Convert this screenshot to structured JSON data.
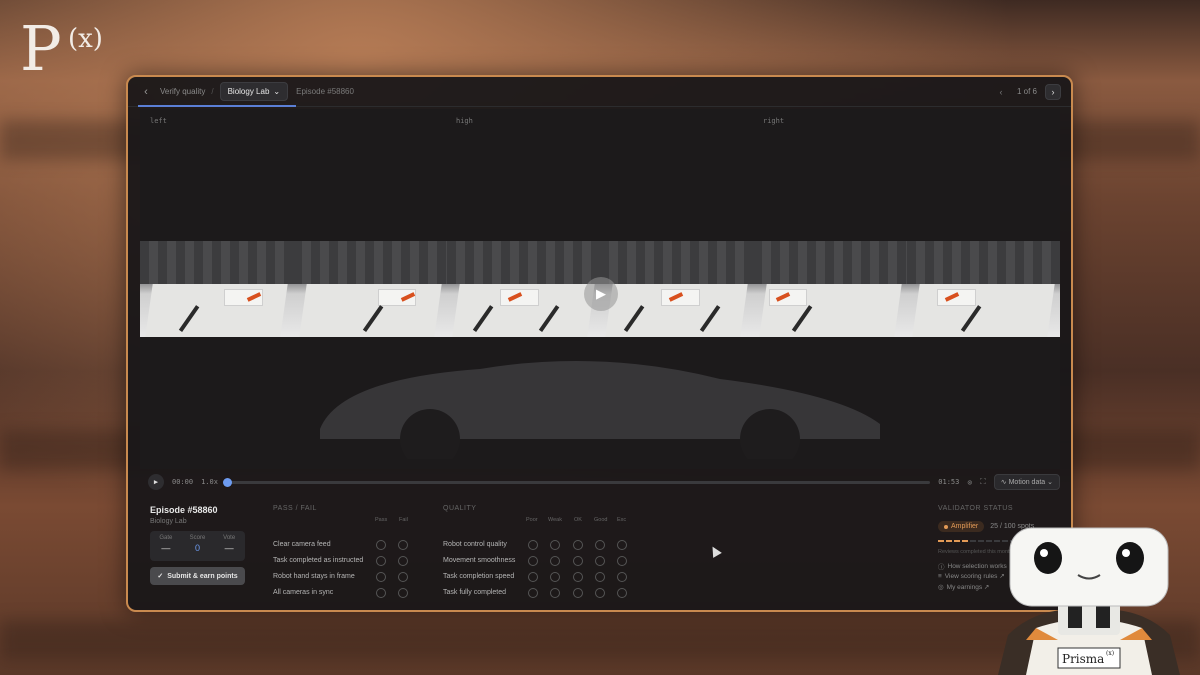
{
  "brand": {
    "logo_letter": "P",
    "logo_super": "(x)"
  },
  "header": {
    "back_icon": "chevron-left-icon",
    "crumb": "Verify quality",
    "project": "Biology Lab",
    "episode": "Episode #58860",
    "pager": "1 of 6"
  },
  "video": {
    "camera_labels": [
      "left",
      "high",
      "right"
    ],
    "time_current": "00:00",
    "speed": "1.0x",
    "time_total": "01:53",
    "progress_fraction": 0.0,
    "motion_button": "Motion data"
  },
  "episode_panel": {
    "title": "Episode #58860",
    "subtitle": "Biology Lab",
    "stats": [
      {
        "label": "Gate",
        "value": "—"
      },
      {
        "label": "Score",
        "value": "0"
      },
      {
        "label": "Vote",
        "value": "—"
      }
    ],
    "submit_label": "Submit & earn points"
  },
  "pass_fail": {
    "heading": "PASS / FAIL",
    "columns": [
      "Pass",
      "Fail"
    ],
    "rows": [
      "Clear camera feed",
      "Task completed as instructed",
      "Robot hand stays in frame",
      "All cameras in sync"
    ]
  },
  "quality": {
    "heading": "QUALITY",
    "columns": [
      "Poor",
      "Weak",
      "OK",
      "Good",
      "Exc"
    ],
    "rows": [
      "Robot control quality",
      "Movement smoothness",
      "Task completion speed",
      "Task fully completed"
    ]
  },
  "validator": {
    "heading": "VALIDATOR STATUS",
    "tier": "Amplifier",
    "count": "25 / 100 spots",
    "progress_fraction": 0.25,
    "note": "Reviews completed this month",
    "links": [
      "How selection works ↗",
      "View scoring rules ↗",
      "My earnings ↗"
    ]
  },
  "mascot": {
    "badge": "Prisma",
    "badge_super": "(x)"
  },
  "colors": {
    "accent": "#c98a4f",
    "blue": "#6d9bf0",
    "amber": "#e39a56"
  }
}
